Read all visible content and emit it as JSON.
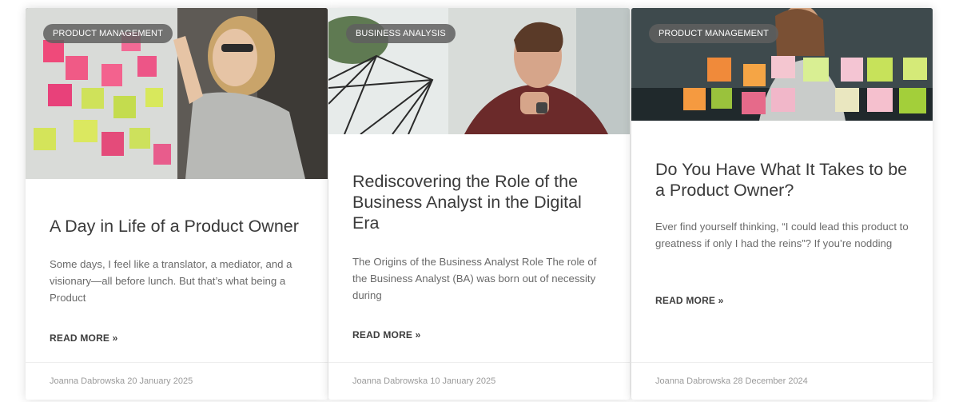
{
  "posts": [
    {
      "category": "PRODUCT MANAGEMENT",
      "title": "A Day in Life of a Product Owner",
      "excerpt": "Some days, I feel like a translator, a mediator, and a visionary—all before lunch. But that’s what being a Product",
      "read_more": "READ MORE »",
      "author": "Joanna Dabrowska",
      "date": "20 January 2025"
    },
    {
      "category": "BUSINESS ANALYSIS",
      "title": "Rediscovering the Role of the Business Analyst in the Digital Era",
      "excerpt": "The Origins of the Business Analyst Role The role of the Business Analyst (BA) was born out of necessity during",
      "read_more": "READ MORE »",
      "author": "Joanna Dabrowska",
      "date": "10 January 2025"
    },
    {
      "category": "PRODUCT MANAGEMENT",
      "title": "Do You Have What It Takes to be a Product Owner?",
      "excerpt": "Ever find yourself thinking, “I could lead this product to greatness if only I had the reins”? If you’re nodding",
      "read_more": "READ MORE »",
      "author": "Joanna Dabrowska",
      "date": "28 December 2024"
    }
  ]
}
